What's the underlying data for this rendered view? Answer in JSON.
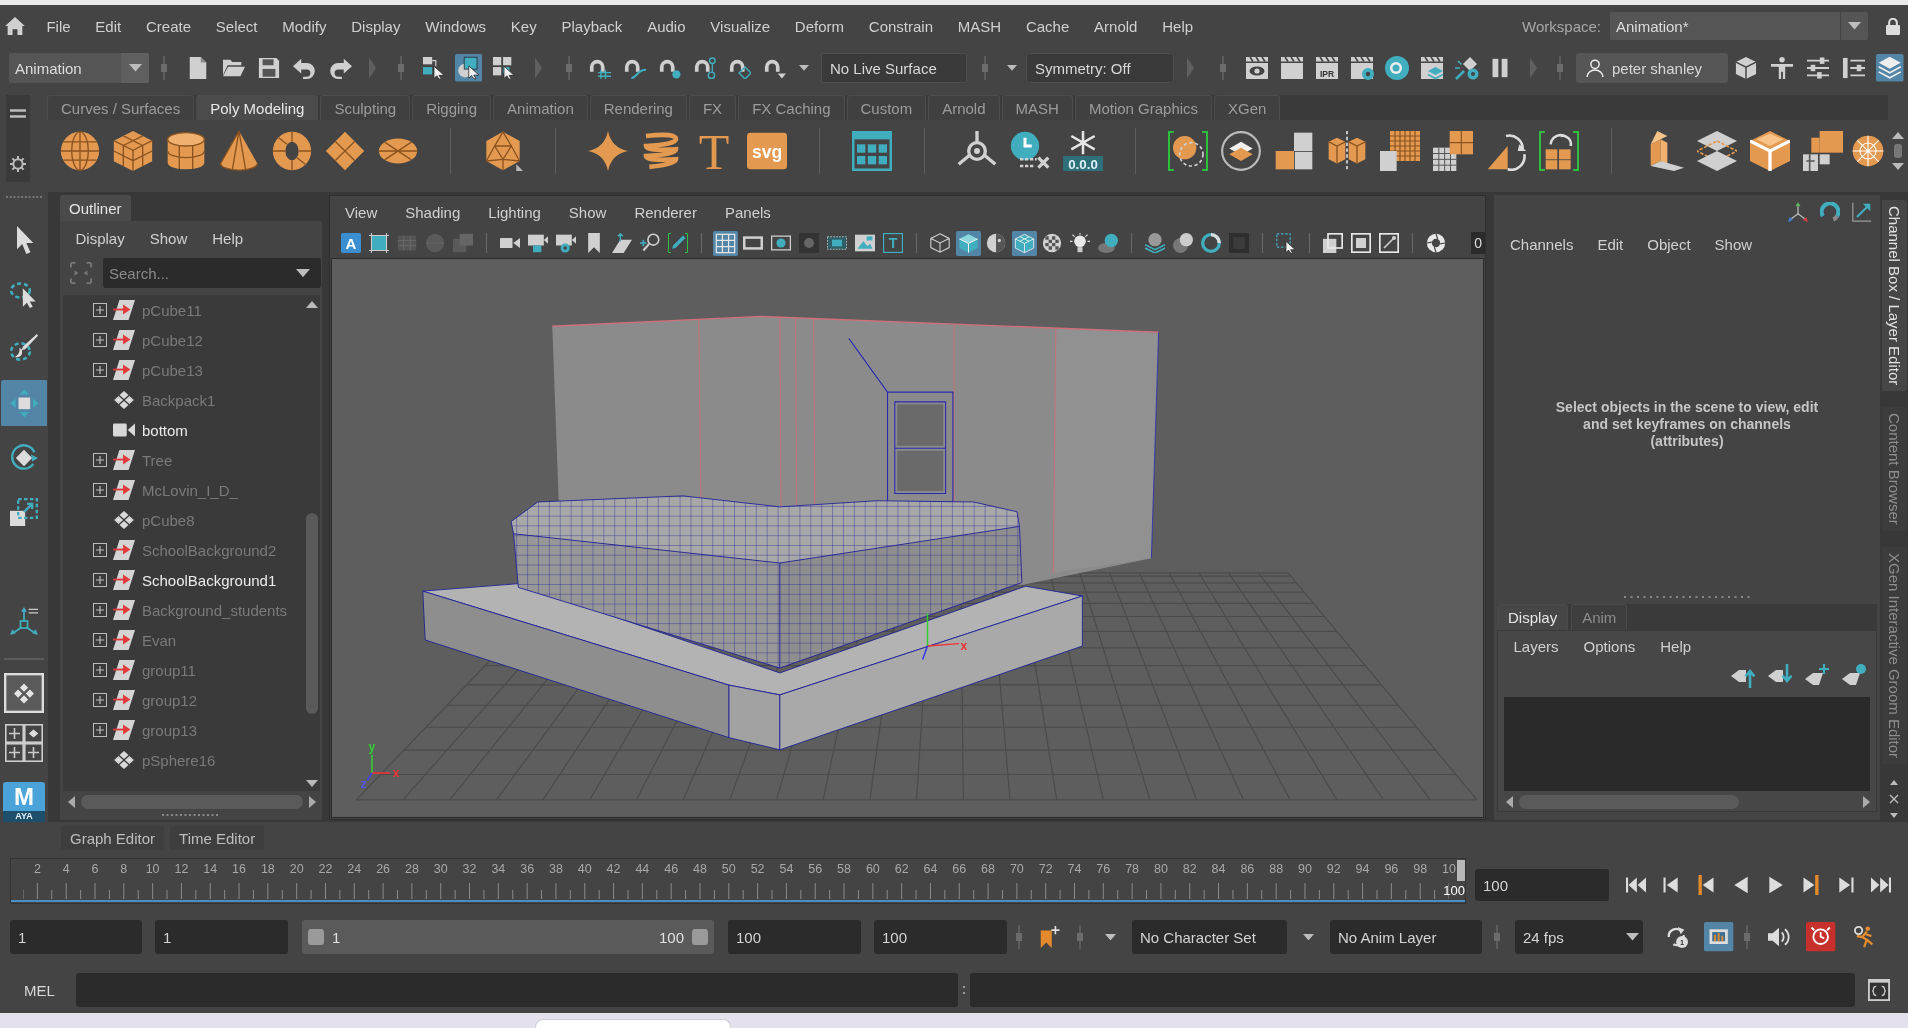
{
  "menu_bar": {
    "items": [
      "File",
      "Edit",
      "Create",
      "Select",
      "Modify",
      "Display",
      "Windows",
      "Key",
      "Playback",
      "Audio",
      "Visualize",
      "Deform",
      "Constrain",
      "MASH",
      "Cache",
      "Arnold",
      "Help"
    ]
  },
  "workspace": {
    "label": "Workspace:",
    "value": "Animation*"
  },
  "status_line": {
    "menu_set": "Animation",
    "selection_modes": [
      {
        "selected": false
      },
      {
        "selected": true
      },
      {
        "selected": false
      }
    ],
    "live_surface": "No Live Surface",
    "symmetry": "Symmetry: Off",
    "ipr_label": "IPR",
    "user": "peter shanley",
    "panel_toggles": [
      {
        "selected": false
      },
      {
        "selected": false
      },
      {
        "selected": false
      },
      {
        "selected": false
      },
      {
        "selected": true
      }
    ]
  },
  "shelf": {
    "tabs": [
      {
        "label": "Curves / Surfaces",
        "selected": false
      },
      {
        "label": "Poly Modeling",
        "selected": true
      },
      {
        "label": "Sculpting",
        "selected": false
      },
      {
        "label": "Rigging",
        "selected": false
      },
      {
        "label": "Animation",
        "selected": false
      },
      {
        "label": "Rendering",
        "selected": false
      },
      {
        "label": "FX",
        "selected": false
      },
      {
        "label": "FX Caching",
        "selected": false
      },
      {
        "label": "Custom",
        "selected": false
      },
      {
        "label": "Arnold",
        "selected": false
      },
      {
        "label": "MASH",
        "selected": false
      },
      {
        "label": "Motion Graphics",
        "selected": false
      },
      {
        "label": "XGen",
        "selected": false
      }
    ],
    "text_tool_label": "T",
    "svg_tool_label": "svg",
    "freeze_label": "0.0.0"
  },
  "toolbox": {
    "tools": [
      {
        "selected": false
      },
      {
        "selected": false
      },
      {
        "selected": false
      },
      {
        "selected": true
      },
      {
        "selected": false
      },
      {
        "selected": false
      },
      {
        "selected": false
      }
    ],
    "layouts": [
      {
        "selected": true
      },
      {
        "selected": false
      }
    ]
  },
  "logo": {
    "letter": "M",
    "caption": "AYA"
  },
  "outliner": {
    "title": "Outliner",
    "menu": [
      "Display",
      "Show",
      "Help"
    ],
    "search": {
      "placeholder": "Search..."
    },
    "items": [
      {
        "label": "pCube11",
        "kind": "group",
        "hidden": true
      },
      {
        "label": "pCube12",
        "kind": "group",
        "hidden": true
      },
      {
        "label": "pCube13",
        "kind": "group",
        "hidden": true
      },
      {
        "label": "Backpack1",
        "kind": "mesh",
        "hidden": true
      },
      {
        "label": "bottom",
        "kind": "camera",
        "hidden": false
      },
      {
        "label": "Tree",
        "kind": "group",
        "hidden": true
      },
      {
        "label": "McLovin_I_D_",
        "kind": "group",
        "hidden": true
      },
      {
        "label": "pCube8",
        "kind": "mesh",
        "hidden": true
      },
      {
        "label": "SchoolBackground2",
        "kind": "group",
        "hidden": true
      },
      {
        "label": "SchoolBackground1",
        "kind": "group",
        "hidden": false
      },
      {
        "label": "Background_students",
        "kind": "group",
        "hidden": true
      },
      {
        "label": "Evan",
        "kind": "group",
        "hidden": true
      },
      {
        "label": "group11",
        "kind": "group",
        "hidden": true
      },
      {
        "label": "group12",
        "kind": "group",
        "hidden": true
      },
      {
        "label": "group13",
        "kind": "group",
        "hidden": true
      },
      {
        "label": "pSphere16",
        "kind": "mesh",
        "hidden": true
      }
    ]
  },
  "viewport": {
    "menu": [
      "View",
      "Shading",
      "Lighting",
      "Show",
      "Renderer",
      "Panels"
    ],
    "camera_label": "A",
    "text_label": "T",
    "toolbar": [
      {
        "selected": false
      },
      {
        "selected": false
      },
      {
        "selected": false
      },
      {
        "selected": false
      },
      {
        "selected": false
      },
      {
        "selected": false
      },
      {
        "selected": false
      },
      {
        "selected": false
      },
      {
        "selected": false
      },
      {
        "selected": false
      },
      {
        "selected": false
      },
      {
        "selected": false
      },
      {
        "selected": true
      },
      {
        "selected": false
      },
      {
        "selected": false
      },
      {
        "selected": false
      },
      {
        "selected": false
      },
      {
        "selected": false
      },
      {
        "selected": false
      },
      {
        "selected": false
      },
      {
        "selected": true
      },
      {
        "selected": false
      },
      {
        "selected": true
      },
      {
        "selected": false
      },
      {
        "selected": false
      },
      {
        "selected": false
      },
      {
        "selected": false
      },
      {
        "selected": false
      },
      {
        "selected": false
      },
      {
        "selected": false
      },
      {
        "selected": false
      },
      {
        "selected": false
      },
      {
        "selected": false
      },
      {
        "selected": false
      },
      {
        "selected": false
      }
    ],
    "exposure_value": "0",
    "manipulator_label": "x",
    "view_axis": {
      "x": "x",
      "y": "y",
      "z": "z"
    }
  },
  "channel_box": {
    "menu": [
      "Channels",
      "Edit",
      "Object",
      "Show"
    ],
    "message": "Select objects in the scene to view, edit and set keyframes on channels (attributes)"
  },
  "layer_editor": {
    "tabs": [
      {
        "label": "Display",
        "selected": true
      },
      {
        "label": "Anim",
        "selected": false
      }
    ],
    "menu": [
      "Layers",
      "Options",
      "Help"
    ]
  },
  "side_tabs": [
    {
      "label": "Channel Box / Layer Editor",
      "selected": true
    },
    {
      "label": "Content Browser",
      "selected": false
    },
    {
      "label": "XGen Interactive Groom Editor",
      "selected": false
    }
  ],
  "bottom_tabs": [
    {
      "label": "Graph Editor",
      "selected": false
    },
    {
      "label": "Time Editor",
      "selected": false
    }
  ],
  "time_slider": {
    "ticks": [
      "2",
      "4",
      "6",
      "8",
      "10",
      "12",
      "14",
      "16",
      "18",
      "20",
      "22",
      "24",
      "26",
      "28",
      "30",
      "32",
      "34",
      "36",
      "38",
      "40",
      "42",
      "44",
      "46",
      "48",
      "50",
      "52",
      "54",
      "56",
      "58",
      "60",
      "62",
      "64",
      "66",
      "68",
      "70",
      "72",
      "74",
      "76",
      "78",
      "80",
      "82",
      "84",
      "86",
      "88",
      "90",
      "92",
      "94",
      "96",
      "98",
      "10"
    ],
    "playhead": {
      "label": "100",
      "level": 1
    },
    "current_frame": "100"
  },
  "range_slider": {
    "animation_start": "1",
    "playback_start": "1",
    "range_start": "1",
    "range_end": "100",
    "level": 1,
    "playback_end": "100",
    "animation_end": "100",
    "character_set": "No Character Set",
    "anim_layer": "No Anim Layer",
    "fps": "24 fps",
    "loop_label": "1",
    "toggles": [
      {
        "selected": false
      },
      {
        "selected": true
      },
      {
        "selected": false
      },
      {
        "selected": true
      }
    ]
  },
  "command_line": {
    "language": "MEL"
  }
}
